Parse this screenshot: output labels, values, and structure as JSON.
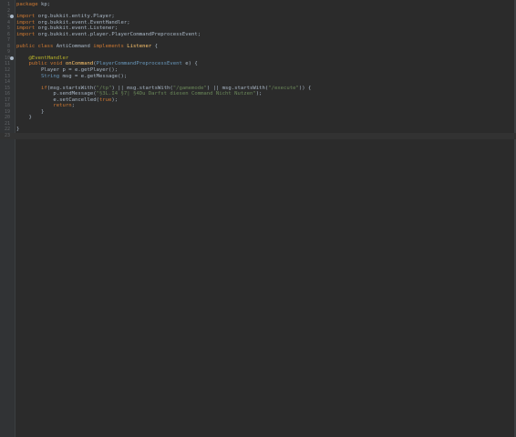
{
  "editor": {
    "lines": [
      {
        "n": "1",
        "marker": false,
        "tokens": [
          [
            "kw",
            "package"
          ],
          [
            "t",
            " kp;"
          ]
        ]
      },
      {
        "n": "2",
        "marker": false,
        "tokens": []
      },
      {
        "n": "3",
        "marker": true,
        "tokens": [
          [
            "kw",
            "import"
          ],
          [
            "t",
            " org.bukkit.entity.Player;"
          ]
        ]
      },
      {
        "n": "4",
        "marker": false,
        "tokens": [
          [
            "kw",
            "import"
          ],
          [
            "t",
            " org.bukkit.event.EventHandler;"
          ]
        ]
      },
      {
        "n": "5",
        "marker": false,
        "tokens": [
          [
            "kw",
            "import"
          ],
          [
            "t",
            " org.bukkit.event.Listener;"
          ]
        ]
      },
      {
        "n": "6",
        "marker": false,
        "tokens": [
          [
            "kw",
            "import"
          ],
          [
            "t",
            " org.bukkit.event.player.PlayerCommandPreprocessEvent;"
          ]
        ]
      },
      {
        "n": "7",
        "marker": false,
        "tokens": []
      },
      {
        "n": "8",
        "marker": false,
        "tokens": [
          [
            "kw",
            "public class "
          ],
          [
            "cls",
            "AntiCommand "
          ],
          [
            "kw",
            "implements "
          ],
          [
            "fn",
            "Listener"
          ],
          [
            "t",
            " {"
          ]
        ]
      },
      {
        "n": "9",
        "marker": false,
        "tokens": []
      },
      {
        "n": "10",
        "marker": true,
        "tokens": [
          [
            "t",
            "    "
          ],
          [
            "ann",
            "@EventHandler"
          ]
        ]
      },
      {
        "n": "11",
        "marker": false,
        "tokens": [
          [
            "t",
            "    "
          ],
          [
            "kw",
            "public void "
          ],
          [
            "fn",
            "onCommand"
          ],
          [
            "t",
            "("
          ],
          [
            "ty",
            "PlayerCommandPreprocessEvent"
          ],
          [
            "t",
            " e) {"
          ]
        ]
      },
      {
        "n": "12",
        "marker": false,
        "tokens": [
          [
            "t",
            "        Player p = e.getPlayer();"
          ]
        ]
      },
      {
        "n": "13",
        "marker": false,
        "tokens": [
          [
            "t",
            "        "
          ],
          [
            "ty",
            "String"
          ],
          [
            "t",
            " msg = e.getMessage();"
          ]
        ]
      },
      {
        "n": "14",
        "marker": false,
        "tokens": []
      },
      {
        "n": "15",
        "marker": false,
        "tokens": [
          [
            "t",
            "        "
          ],
          [
            "kw",
            "if"
          ],
          [
            "t",
            "(msg.startsWith("
          ],
          [
            "str",
            "\"/tp\""
          ],
          [
            "t",
            ") || msg.startsWith("
          ],
          [
            "str",
            "\"/gamemode\""
          ],
          [
            "t",
            ") || msg.startsWith("
          ],
          [
            "str",
            "\"/execute\""
          ],
          [
            "t",
            ")) {"
          ]
        ]
      },
      {
        "n": "16",
        "marker": false,
        "tokens": [
          [
            "t",
            "            p.sendMessage("
          ],
          [
            "str",
            "\"§3L.I4 §7| §4Du Darfst diesen Command Nicht Nutzen\""
          ],
          [
            "t",
            ");"
          ]
        ]
      },
      {
        "n": "17",
        "marker": false,
        "tokens": [
          [
            "t",
            "            e.setCancelled("
          ],
          [
            "kw",
            "true"
          ],
          [
            "t",
            ");"
          ]
        ]
      },
      {
        "n": "18",
        "marker": false,
        "tokens": [
          [
            "t",
            "            "
          ],
          [
            "kw",
            "return"
          ],
          [
            "t",
            ";"
          ]
        ]
      },
      {
        "n": "19",
        "marker": false,
        "tokens": [
          [
            "t",
            "        }"
          ]
        ]
      },
      {
        "n": "20",
        "marker": false,
        "tokens": [
          [
            "t",
            "    }"
          ]
        ]
      },
      {
        "n": "21",
        "marker": false,
        "tokens": []
      },
      {
        "n": "22",
        "marker": false,
        "tokens": [
          [
            "t",
            "}"
          ]
        ]
      },
      {
        "n": "23",
        "marker": false,
        "current": true,
        "tokens": []
      }
    ]
  },
  "colors": {
    "background": "#2b2b2b",
    "gutter": "#313335",
    "keyword": "#cc7832",
    "string": "#6a8759",
    "annotation": "#bbb529",
    "type": "#6897bb",
    "method": "#ffc66d",
    "text": "#a9b7c6"
  }
}
